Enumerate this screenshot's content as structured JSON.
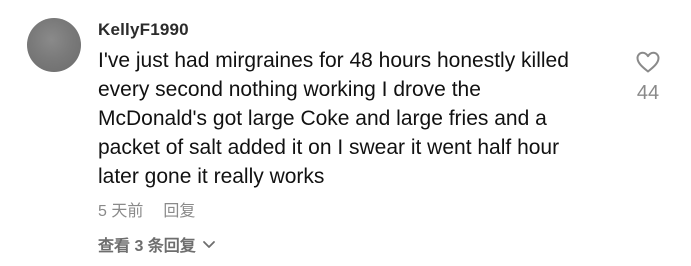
{
  "comment": {
    "username": "KellyF1990",
    "text_lines": [
      "I've just had mirgraines for 48 hours honestly killed",
      "every second nothing working I drove the",
      "McDonald's got large Coke and large fries and a",
      "packet of salt added it on I swear it went half hour",
      "later gone it really works"
    ],
    "timestamp": "5 天前",
    "reply_label": "回复",
    "like_count": "44",
    "view_replies_label": "查看 3 条回复"
  },
  "colors": {
    "avatar": "#7a7a7a",
    "text": "#111111",
    "muted": "#8a8a8a"
  },
  "icons": {
    "like": "heart-outline-icon",
    "expand": "chevron-down-icon"
  }
}
